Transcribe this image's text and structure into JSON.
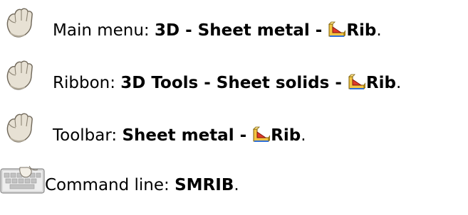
{
  "access_methods": [
    {
      "icon": "mouse-hand-icon",
      "prefix": "Main menu: ",
      "path": "3D - Sheet metal - ",
      "command_icon": "sheet-metal-rib-icon",
      "command": "Rib",
      "suffix": "."
    },
    {
      "icon": "mouse-hand-icon",
      "prefix": "Ribbon: ",
      "path": "3D Tools - Sheet solids - ",
      "command_icon": "sheet-metal-rib-icon",
      "command": "Rib",
      "suffix": "."
    },
    {
      "icon": "mouse-hand-icon",
      "prefix": "Toolbar: ",
      "path": "Sheet metal - ",
      "command_icon": "sheet-metal-rib-icon",
      "command": "Rib",
      "suffix": "."
    },
    {
      "icon": "keyboard-icon",
      "prefix": "Command line: ",
      "command": "SMRIB",
      "suffix": "."
    }
  ]
}
